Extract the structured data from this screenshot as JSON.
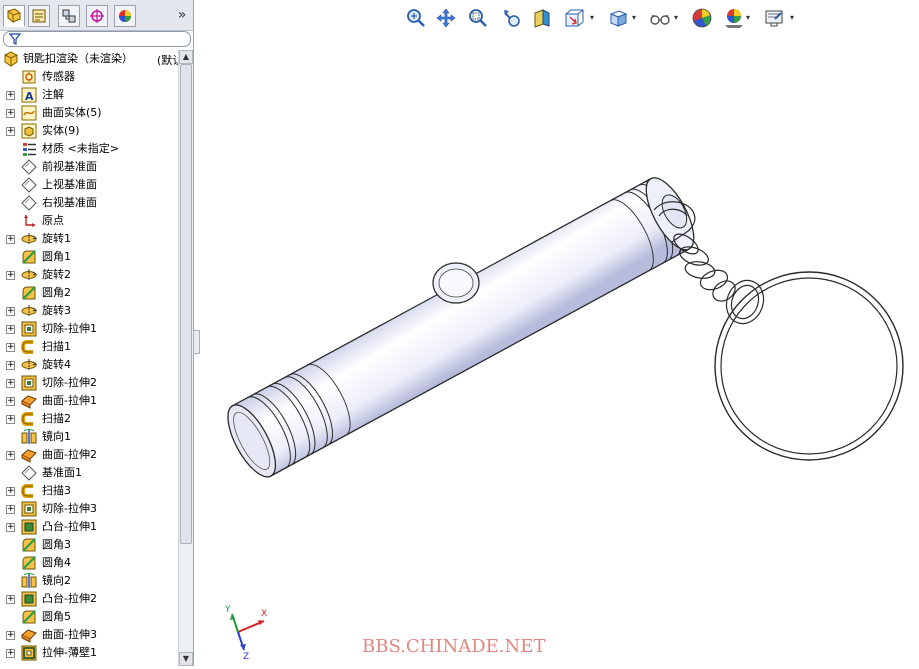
{
  "feature_manager": {
    "tabs": [
      {
        "icon": "feature-tree-icon",
        "active": true
      },
      {
        "icon": "property-manager-icon"
      },
      {
        "icon": "configuration-manager-icon"
      },
      {
        "icon": "dimxpert-icon"
      },
      {
        "icon": "display-manager-icon"
      }
    ],
    "more_label": "»",
    "filter_icon": "filter-icon",
    "root": {
      "label": "钥匙扣渲染（未渲染）",
      "suffix": "(默认"
    },
    "items": [
      {
        "label": "传感器",
        "icon": "sensor",
        "expand": false
      },
      {
        "label": "注解",
        "icon": "annotation",
        "expand": true
      },
      {
        "label": "曲面实体(5)",
        "icon": "surface-body",
        "expand": true
      },
      {
        "label": "实体(9)",
        "icon": "solid-body",
        "expand": true
      },
      {
        "label": "材质 <未指定>",
        "icon": "material",
        "expand": false
      },
      {
        "label": "前视基准面",
        "icon": "plane",
        "expand": false
      },
      {
        "label": "上视基准面",
        "icon": "plane",
        "expand": false
      },
      {
        "label": "右视基准面",
        "icon": "plane",
        "expand": false
      },
      {
        "label": "原点",
        "icon": "origin",
        "expand": false
      },
      {
        "label": "旋转1",
        "icon": "revolve",
        "expand": true
      },
      {
        "label": "圆角1",
        "icon": "fillet",
        "expand": false
      },
      {
        "label": "旋转2",
        "icon": "revolve",
        "expand": true
      },
      {
        "label": "圆角2",
        "icon": "fillet",
        "expand": false
      },
      {
        "label": "旋转3",
        "icon": "revolve",
        "expand": true
      },
      {
        "label": "切除-拉伸1",
        "icon": "cut-extrude",
        "expand": true
      },
      {
        "label": "扫描1",
        "icon": "sweep",
        "expand": true
      },
      {
        "label": "旋转4",
        "icon": "revolve",
        "expand": true
      },
      {
        "label": "切除-拉伸2",
        "icon": "cut-extrude",
        "expand": true
      },
      {
        "label": "曲面-拉伸1",
        "icon": "surface-extrude",
        "expand": true
      },
      {
        "label": "扫描2",
        "icon": "sweep",
        "expand": true
      },
      {
        "label": "镜向1",
        "icon": "mirror",
        "expand": false
      },
      {
        "label": "曲面-拉伸2",
        "icon": "surface-extrude",
        "expand": true
      },
      {
        "label": "基准面1",
        "icon": "plane",
        "expand": false
      },
      {
        "label": "扫描3",
        "icon": "sweep",
        "expand": true
      },
      {
        "label": "切除-拉伸3",
        "icon": "cut-extrude",
        "expand": true
      },
      {
        "label": "凸台-拉伸1",
        "icon": "boss-extrude",
        "expand": true
      },
      {
        "label": "圆角3",
        "icon": "fillet",
        "expand": false
      },
      {
        "label": "圆角4",
        "icon": "fillet",
        "expand": false
      },
      {
        "label": "镜向2",
        "icon": "mirror",
        "expand": false
      },
      {
        "label": "凸台-拉伸2",
        "icon": "boss-extrude",
        "expand": true
      },
      {
        "label": "圆角5",
        "icon": "fillet",
        "expand": false
      },
      {
        "label": "曲面-拉伸3",
        "icon": "surface-extrude",
        "expand": true
      },
      {
        "label": "拉伸-薄壁1",
        "icon": "thin-extrude",
        "expand": true
      }
    ]
  },
  "view_toolbar": [
    "zoom-to-fit-icon",
    "pan-icon",
    "zoom-area-icon",
    "previous-view-icon",
    "section-view-icon",
    "view-orientation-icon",
    "display-style-icon",
    "hide-show-icon",
    "edit-appearance-icon",
    "apply-scene-icon",
    "view-settings-icon"
  ],
  "triad": {
    "x_label": "X",
    "y_label": "Y",
    "z_label": "Z"
  },
  "watermark": "BBS.CHINADE.NET",
  "colors": {
    "tree_bg": "#ffffff",
    "panel_border": "#9aa3ad",
    "model_fill": "#eef0fb",
    "model_edge": "#2a2a2a",
    "watermark": "#e0877f"
  }
}
